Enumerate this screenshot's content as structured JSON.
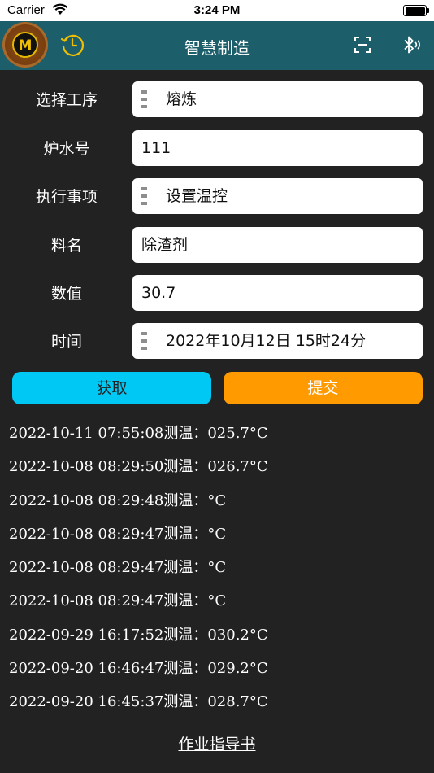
{
  "status_bar": {
    "carrier": "Carrier",
    "time": "3:24 PM"
  },
  "nav": {
    "logo_letter": "M",
    "title": "智慧制造"
  },
  "form": {
    "process": {
      "label": "选择工序",
      "value": "熔炼"
    },
    "furnace": {
      "label": "炉水号",
      "value": "111"
    },
    "task": {
      "label": "执行事项",
      "value": "设置温控"
    },
    "material": {
      "label": "料名",
      "value": "除渣剂"
    },
    "amount": {
      "label": "数值",
      "value": "30.7"
    },
    "time": {
      "label": "时间",
      "value": "2022年10月12日 15时24分"
    }
  },
  "buttons": {
    "fetch_label": "获取",
    "submit_label": "提交"
  },
  "logs": [
    "2022-10-11 07:55:08测温：025.7°C",
    "2022-10-08 08:29:50测温：026.7°C",
    "2022-10-08 08:29:48测温：°C",
    "2022-10-08 08:29:47测温：°C",
    "2022-10-08 08:29:47测温：°C",
    "2022-10-08 08:29:47测温：°C",
    "2022-09-29 16:17:52测温：030.2°C",
    "2022-09-20 16:46:47测温：029.2°C",
    "2022-09-20 16:45:37测温：028.7°C"
  ],
  "footer": {
    "guide_link": "作业指导书"
  },
  "colors": {
    "nav_background": "#1c5f6b",
    "page_background": "#222222",
    "fetch_button": "#00c8f5",
    "submit_button": "#ff9a00",
    "history_icon": "#f0c000"
  },
  "icons": {
    "wifi": "wifi-icon",
    "battery": "battery-icon",
    "history": "history-clock-icon",
    "scan": "scan-icon",
    "bluetooth": "bluetooth-icon"
  }
}
